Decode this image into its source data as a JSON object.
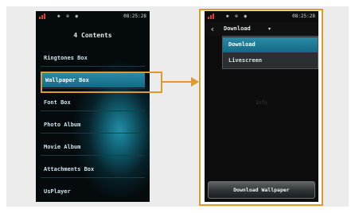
{
  "phone1": {
    "status_time": "08:25:28",
    "title": "4 Contents",
    "menu": [
      {
        "label": "Ringtones Box"
      },
      {
        "label": "Wallpaper Box"
      },
      {
        "label": "Font Box"
      },
      {
        "label": "Photo Album"
      },
      {
        "label": "Movie Album"
      },
      {
        "label": "Attachments Box"
      },
      {
        "label": "UsPlayer"
      }
    ]
  },
  "phone2": {
    "status_time": "08:25:28",
    "title": "Download",
    "dropdown_options": [
      "Download",
      "Livescreen"
    ],
    "empty_text": "Info",
    "button_label": "Download Wallpaper"
  },
  "colors": {
    "highlight": "#e09a2a",
    "selection": "#1f7f9c",
    "signal": "#e53935"
  }
}
